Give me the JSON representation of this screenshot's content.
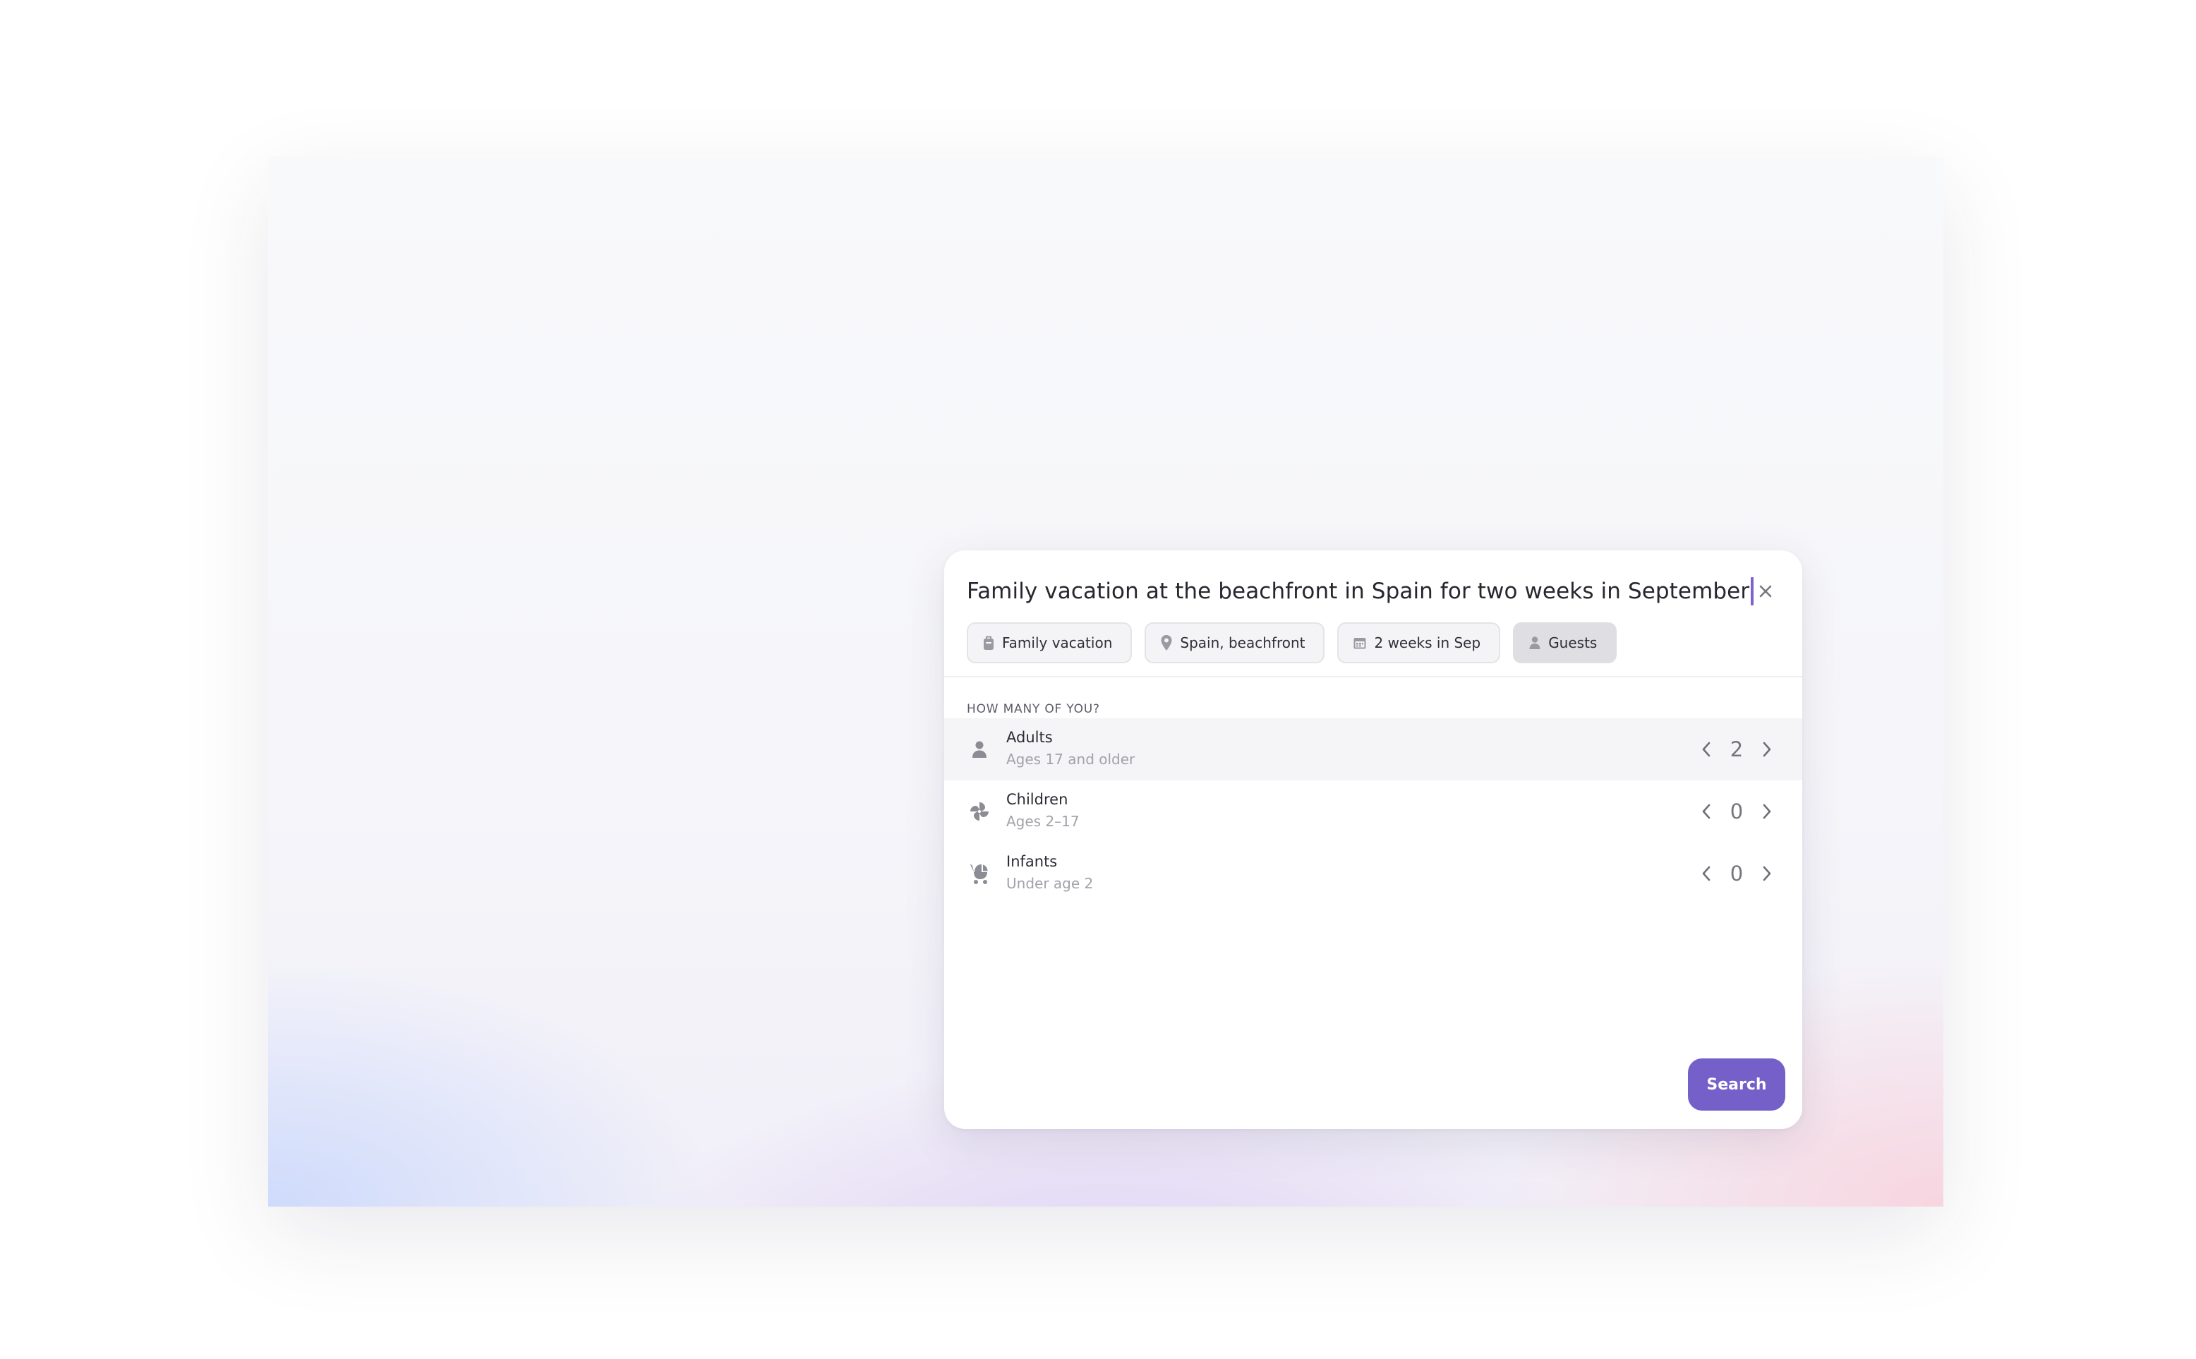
{
  "search": {
    "query": "Family vacation at the beachfront in Spain for two weeks in September"
  },
  "chips": [
    {
      "label": "Family vacation",
      "icon": "luggage-icon"
    },
    {
      "label": "Spain, beachfront",
      "icon": "location-pin-icon"
    },
    {
      "label": "2 weeks in Sep",
      "icon": "calendar-icon"
    },
    {
      "label": "Guests",
      "icon": "person-icon",
      "active": true
    }
  ],
  "guests": {
    "section_label": "How many of you?",
    "rows": [
      {
        "title": "Adults",
        "subtitle": "Ages 17 and older",
        "count": "2",
        "icon": "person-icon"
      },
      {
        "title": "Children",
        "subtitle": "Ages 2–17",
        "count": "0",
        "icon": "pinwheel-icon"
      },
      {
        "title": "Infants",
        "subtitle": "Under age 2",
        "count": "0",
        "icon": "stroller-icon"
      }
    ]
  },
  "actions": {
    "search_label": "Search"
  },
  "colors": {
    "accent": "#7460c8",
    "caret": "#7c63cf",
    "chip_bg": "#f4f4f6",
    "chip_active_bg": "#dedee3",
    "text_primary": "#27272e",
    "text_secondary": "#a2a2aa"
  }
}
